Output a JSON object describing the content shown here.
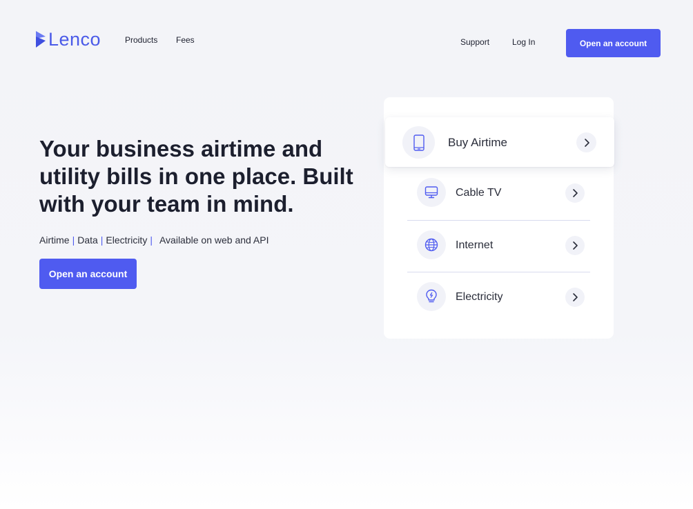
{
  "brand": {
    "name": "Lenco",
    "color": "#4a5ae8"
  },
  "nav": {
    "products": "Products",
    "fees": "Fees",
    "support": "Support",
    "login": "Log In",
    "cta": "Open an account"
  },
  "hero": {
    "title": "Your business airtime and utility bills in one place. Built with your team in mind.",
    "features": [
      "Airtime",
      "Data",
      "Electricity"
    ],
    "separator": "|",
    "availability": "Available on web and API",
    "cta": "Open an account"
  },
  "services": {
    "items": [
      {
        "label": "Buy Airtime",
        "icon": "phone-icon",
        "active": true
      },
      {
        "label": "Cable TV",
        "icon": "monitor-icon",
        "active": false
      },
      {
        "label": "Internet",
        "icon": "globe-icon",
        "active": false
      },
      {
        "label": "Electricity",
        "icon": "lightbulb-icon",
        "active": false
      }
    ]
  },
  "colors": {
    "accent": "#4f5bf0",
    "background": "#f3f4f8",
    "text": "#1c1f2e"
  }
}
